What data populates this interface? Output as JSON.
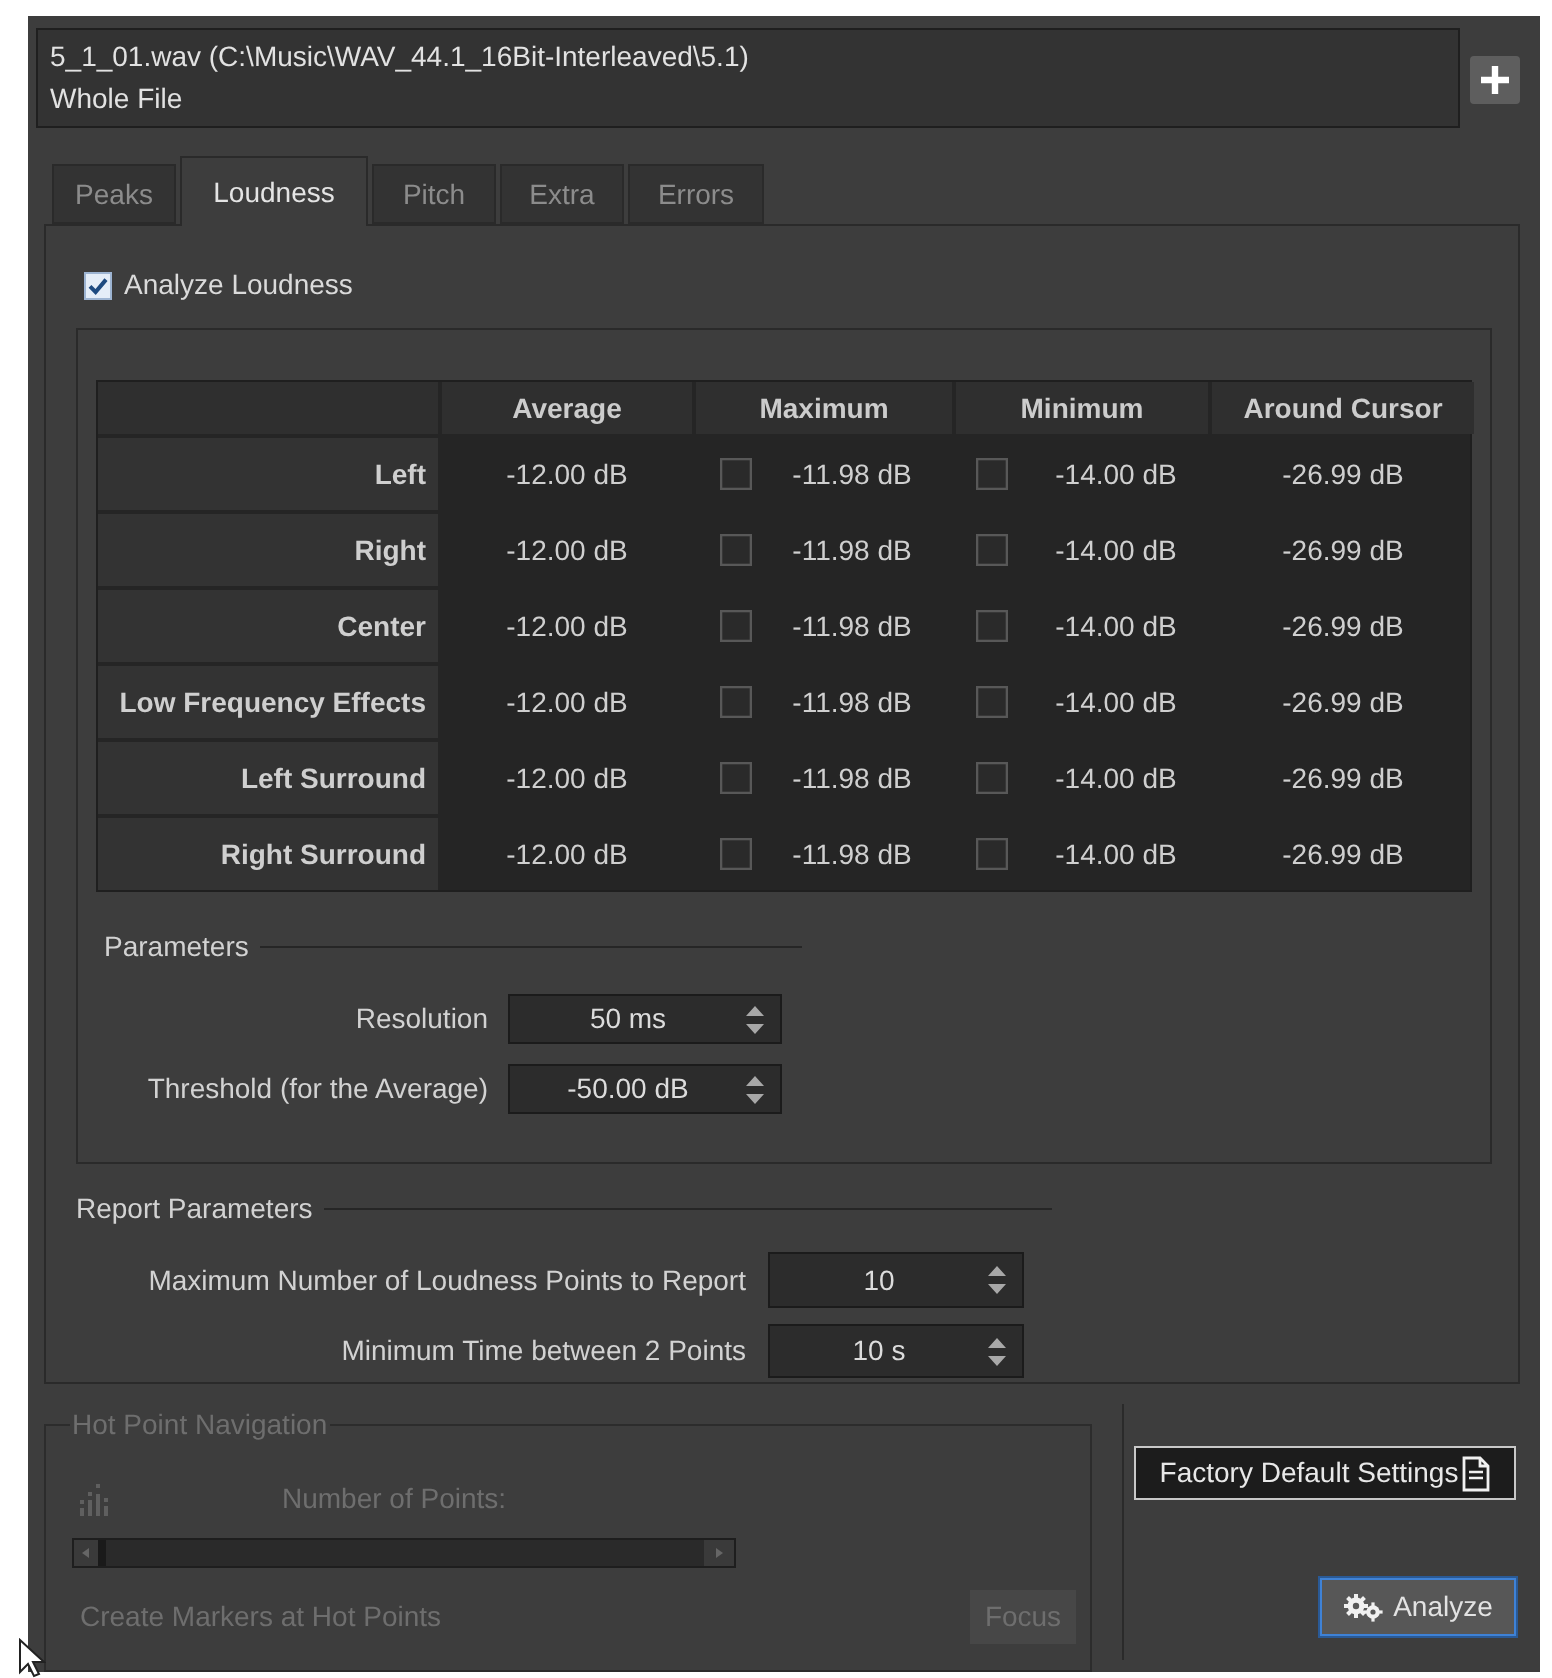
{
  "file": {
    "path": "5_1_01.wav (C:\\Music\\WAV_44.1_16Bit-Interleaved\\5.1)",
    "range": "Whole File"
  },
  "tabs": [
    {
      "label": "Peaks",
      "selected": false
    },
    {
      "label": "Loudness",
      "selected": true
    },
    {
      "label": "Pitch",
      "selected": false
    },
    {
      "label": "Extra",
      "selected": false
    },
    {
      "label": "Errors",
      "selected": false
    }
  ],
  "analyze_loudness": {
    "label": "Analyze Loudness",
    "checked": true
  },
  "table": {
    "columns": [
      "Average",
      "Maximum",
      "Minimum",
      "Around Cursor"
    ],
    "rows": [
      {
        "name": "Left",
        "average": "-12.00 dB",
        "maximum": {
          "value": "-11.98 dB",
          "checked": false
        },
        "minimum": {
          "value": "-14.00 dB",
          "checked": false
        },
        "around_cursor": "-26.99 dB"
      },
      {
        "name": "Right",
        "average": "-12.00 dB",
        "maximum": {
          "value": "-11.98 dB",
          "checked": false
        },
        "minimum": {
          "value": "-14.00 dB",
          "checked": false
        },
        "around_cursor": "-26.99 dB"
      },
      {
        "name": "Center",
        "average": "-12.00 dB",
        "maximum": {
          "value": "-11.98 dB",
          "checked": false
        },
        "minimum": {
          "value": "-14.00 dB",
          "checked": false
        },
        "around_cursor": "-26.99 dB"
      },
      {
        "name": "Low Frequency Effects",
        "average": "-12.00 dB",
        "maximum": {
          "value": "-11.98 dB",
          "checked": false
        },
        "minimum": {
          "value": "-14.00 dB",
          "checked": false
        },
        "around_cursor": "-26.99 dB"
      },
      {
        "name": "Left Surround",
        "average": "-12.00 dB",
        "maximum": {
          "value": "-11.98 dB",
          "checked": false
        },
        "minimum": {
          "value": "-14.00 dB",
          "checked": false
        },
        "around_cursor": "-26.99 dB"
      },
      {
        "name": "Right Surround",
        "average": "-12.00 dB",
        "maximum": {
          "value": "-11.98 dB",
          "checked": false
        },
        "minimum": {
          "value": "-14.00 dB",
          "checked": false
        },
        "around_cursor": "-26.99 dB"
      }
    ]
  },
  "parameters": {
    "title": "Parameters",
    "fields": [
      {
        "label": "Resolution",
        "value": "50 ms"
      },
      {
        "label": "Threshold (for the Average)",
        "value": "-50.00 dB"
      }
    ]
  },
  "report_parameters": {
    "title": "Report Parameters",
    "fields": [
      {
        "label": "Maximum Number of Loudness Points to Report",
        "value": "10"
      },
      {
        "label": "Minimum Time between 2 Points",
        "value": "10 s"
      }
    ]
  },
  "hot_point_navigation": {
    "title": "Hot Point Navigation",
    "disabled": true,
    "number_of_points_label": "Number of Points:",
    "slider": {
      "level": 0
    },
    "create_markers_label": "Create Markers at Hot Points",
    "focus_button": {
      "label": "Focus"
    }
  },
  "buttons": [
    {
      "kind": "factory",
      "label": "Factory Default Settings",
      "focused": false
    },
    {
      "kind": "analyze",
      "label": "Analyze",
      "focused": true
    }
  ]
}
